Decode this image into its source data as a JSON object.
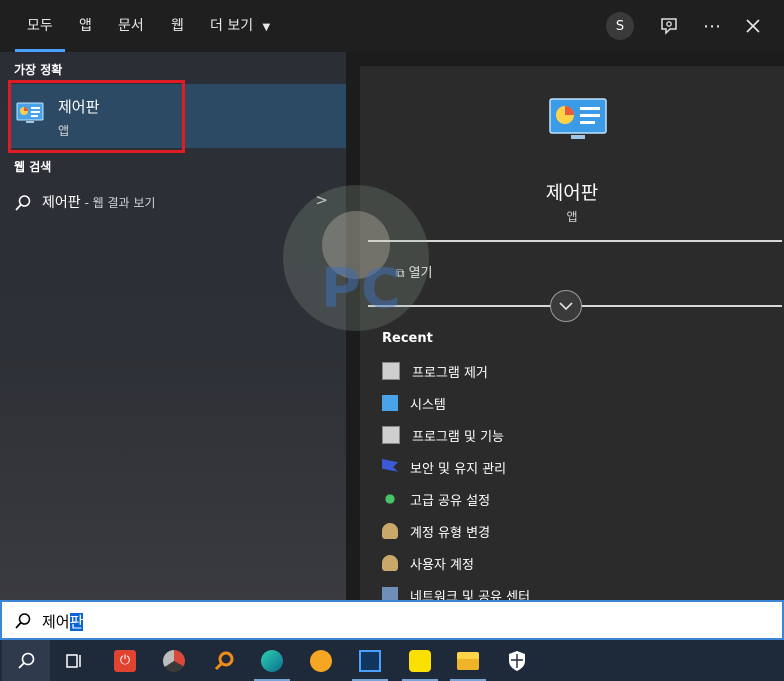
{
  "tabs": [
    {
      "label": "모두"
    },
    {
      "label": "앱"
    },
    {
      "label": "문서"
    },
    {
      "label": "웹"
    },
    {
      "label": "더 보기"
    }
  ],
  "header": {
    "avatar_initial": "S"
  },
  "left": {
    "best_match_label": "가장 정확",
    "best_match": {
      "title": "제어판",
      "subtitle": "앱"
    },
    "web_search_label": "웹 검색",
    "web_result": {
      "query": "제어판",
      "suffix": " - 웹 결과 보기"
    }
  },
  "detail": {
    "title": "제어판",
    "subtitle": "앱",
    "open_label": "열기",
    "recent_label": "Recent",
    "recent_items": [
      {
        "label": "프로그램 제거"
      },
      {
        "label": "시스템"
      },
      {
        "label": "프로그램 및 기능"
      },
      {
        "label": "보안 및 유지 관리"
      },
      {
        "label": "고급 공유 설정"
      },
      {
        "label": "계정 유형 변경"
      },
      {
        "label": "사용자 계정"
      },
      {
        "label": "네트워크 및 공유 센터"
      }
    ]
  },
  "search": {
    "typed": "제어",
    "selected": "판"
  },
  "taskbar": {
    "icons": [
      "search-icon",
      "task-view-icon",
      "power-app-icon",
      "chrome-like-icon",
      "search-app-icon",
      "media-app-icon",
      "face-app-icon",
      "outlook-like-icon",
      "kakaotalk-icon",
      "file-explorer-icon",
      "security-shield-icon"
    ]
  },
  "colors": {
    "accent": "#4aa0ff",
    "highlight_box": "#e01b24",
    "best_match_bg": "#2c4a63",
    "taskbar": "#1e2939"
  }
}
